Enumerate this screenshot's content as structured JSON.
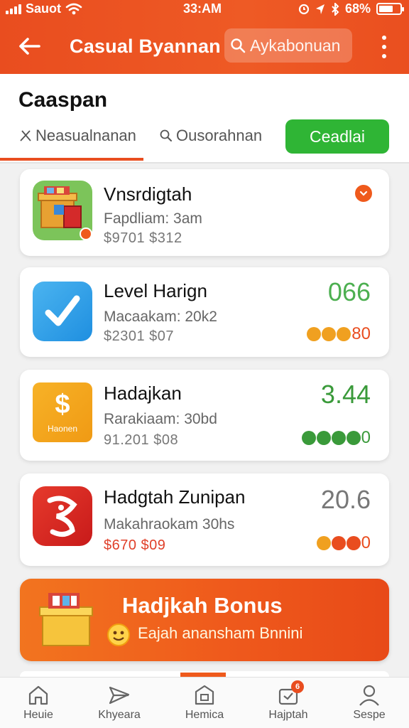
{
  "status_bar": {
    "carrier": "Sauot",
    "time": "33:AM",
    "battery": "68%",
    "battery_level": 0.68
  },
  "header": {
    "title": "Casual Byannan",
    "search_placeholder": "Aykabonuan",
    "icons": [
      "back-arrow-icon",
      "search-icon",
      "more-vertical-icon"
    ]
  },
  "section": {
    "title": "Caaspan",
    "tabs": [
      {
        "label": "Neasualnanan",
        "icon": "swords-icon",
        "active": true
      },
      {
        "label": "Ousorahnan",
        "icon": "search-icon",
        "active": false
      }
    ],
    "action_button": "Ceadlai"
  },
  "cards": [
    {
      "title": "Vnsrdigtah",
      "subtitle": "Fapdliam: 3am",
      "price": "$9701  $312",
      "score": "",
      "rating_value": "",
      "icon": "treasure-box-icon",
      "badge_icon": "chevron-badge-icon"
    },
    {
      "title": "Level Harign",
      "subtitle": "Macaakam: 20k2",
      "price": "$2301  $07",
      "score": "066",
      "score_color": "#4caf50",
      "rating_value": "80",
      "rating_color": "#e94d1f",
      "dot_colors": [
        "#f0a020",
        "#f0a020",
        "#f0a020"
      ],
      "icon": "checkmark-app-icon"
    },
    {
      "title": "Hadajkan",
      "subtitle": "Rarakiaam: 30bd",
      "price": "91.201  $08",
      "score": "3.44",
      "score_color": "#3a9a3a",
      "rating_value": "0",
      "rating_color": "#3a9a3a",
      "dot_colors": [
        "#3a9a3a",
        "#3a9a3a",
        "#3a9a3a",
        "#3a9a3a"
      ],
      "icon": "dollar-card-icon",
      "icon_label": "Haonen"
    },
    {
      "title": "Hadgtah Zunipan",
      "subtitle": "Makahraokam 30hs",
      "price": "$670  $09",
      "price_color": "#e0402a",
      "score": "20.6",
      "score_color": "#777777",
      "rating_value": "0",
      "rating_color": "#e94d1f",
      "dot_colors": [
        "#f0a020",
        "#e94d1f",
        "#e94d1f"
      ],
      "icon": "red-app-icon"
    }
  ],
  "bonus": {
    "title": "Hadjkah Bonus",
    "subtitle": "Eajah anansham Bnnini",
    "icons": [
      "gift-box-icon",
      "sun-face-icon"
    ]
  },
  "bottom_nav": [
    {
      "label": "Heuie",
      "icon": "home-icon"
    },
    {
      "label": "Khyeara",
      "icon": "send-icon"
    },
    {
      "label": "Hemica",
      "icon": "store-icon"
    },
    {
      "label": "Hajptah",
      "icon": "cart-icon",
      "badge": "6"
    },
    {
      "label": "Sespe",
      "icon": "profile-icon"
    }
  ],
  "colors": {
    "primary": "#e94d1f",
    "green": "#2fb535"
  }
}
